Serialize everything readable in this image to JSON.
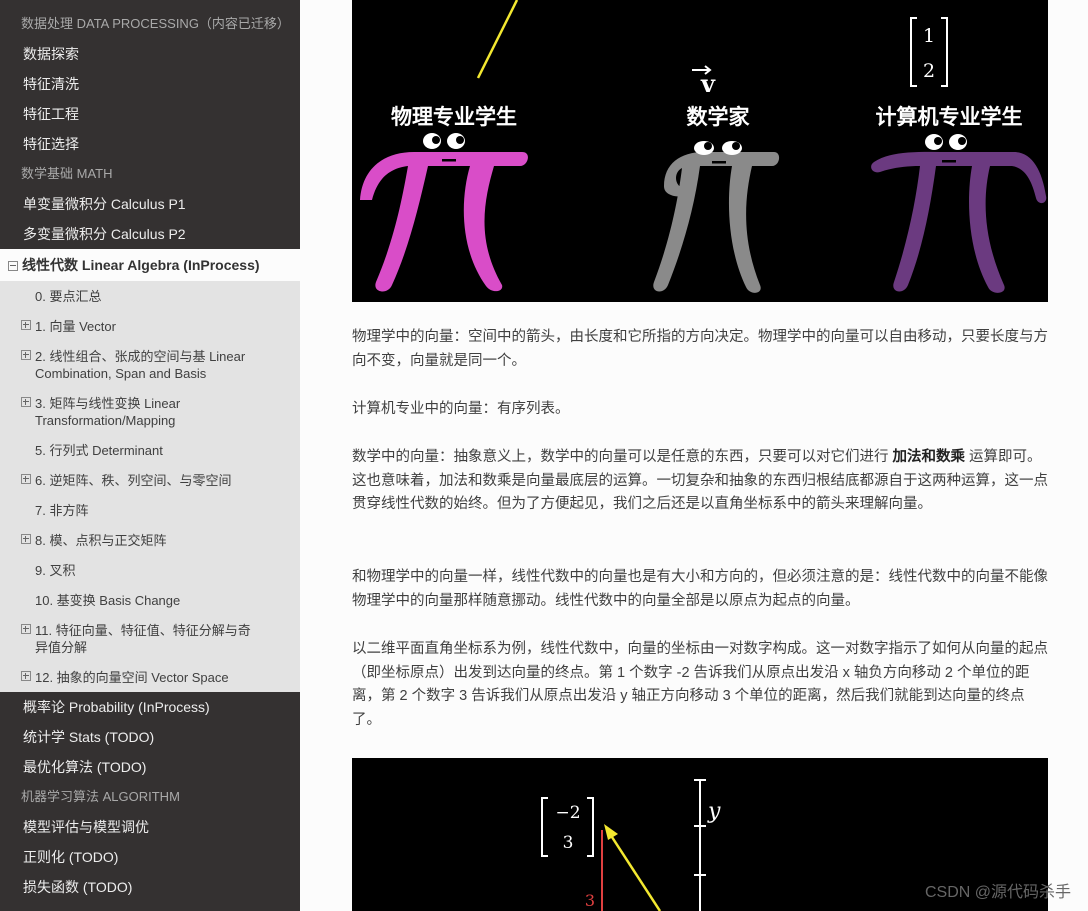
{
  "sidebar": {
    "sections": [
      {
        "caption": "数据处理 DATA PROCESSING（内容已迁移）",
        "items": [
          "数据探索",
          "特征清洗",
          "特征工程",
          "特征选择"
        ]
      },
      {
        "caption": "数学基础 MATH",
        "items": [
          "单变量微积分 Calculus P1",
          "多变量微积分 Calculus P2"
        ]
      }
    ],
    "current": {
      "label": "线性代数 Linear Algebra (InProcess)",
      "subitems": [
        {
          "label": "0. 要点汇总",
          "expandable": false
        },
        {
          "label": "1. 向量 Vector",
          "expandable": true
        },
        {
          "label": "2. 线性组合、张成的空间与基 Linear Combination, Span and Basis",
          "expandable": true
        },
        {
          "label": "3. 矩阵与线性变换 Linear Transformation/Mapping",
          "expandable": true
        },
        {
          "label": "5. 行列式 Determinant",
          "expandable": false
        },
        {
          "label": "6. 逆矩阵、秩、列空间、与零空间",
          "expandable": true
        },
        {
          "label": "7. 非方阵",
          "expandable": false
        },
        {
          "label": "8. 模、点积与正交矩阵",
          "expandable": true
        },
        {
          "label": "9. 叉积",
          "expandable": false
        },
        {
          "label": "10. 基变换 Basis Change",
          "expandable": false
        },
        {
          "label": "11. 特征向量、特征值、特征分解与奇异值分解",
          "expandable": true
        },
        {
          "label": "12. 抽象的向量空间 Vector Space",
          "expandable": true
        }
      ]
    },
    "after_current": [
      "概率论 Probability (InProcess)",
      "统计学 Stats (TODO)",
      "最优化算法 (TODO)"
    ],
    "sections2": [
      {
        "caption": "机器学习算法 ALGORITHM",
        "items": [
          "模型评估与模型调优",
          "正则化 (TODO)",
          "损失函数 (TODO)"
        ]
      }
    ]
  },
  "figure1": {
    "labels": [
      "物理专业学生",
      "数学家",
      "计算机专业学生"
    ],
    "vector_symbol": "v",
    "matrix": [
      "1",
      "2"
    ]
  },
  "paragraphs": [
    "物理学中的向量：空间中的箭头，由长度和它所指的方向决定。物理学中的向量可以自由移动，只要长度与方向不变，向量就是同一个。",
    "计算机专业中的向量：有序列表。",
    "数学中的向量：抽象意义上，数学中的向量可以是任意的东西，只要可以对它们进行 ",
    "加法和数乘",
    " 运算即可。这也意味着，加法和数乘是向量最底层的运算。一切复杂和抽象的东西归根结底都源自于这两种运算，这一点贯穿线性代数的始终。但为了方便起见，我们之后还是以直角坐标系中的箭头来理解向量。",
    "和物理学中的向量一样，线性代数中的向量也是有大小和方向的，但必须注意的是：线性代数中的向量不能像物理学中的向量那样随意挪动。线性代数中的向量全部是以原点为起点的向量。",
    "以二维平面直角坐标系为例，线性代数中，向量的坐标由一对数字构成。这一对数字指示了如何从向量的起点（即坐标原点）出发到达向量的终点。第 1 个数字 -2 告诉我们从原点出发沿 x 轴负方向移动 2 个单位的距离，第 2 个数字 3 告诉我们从原点出发沿 y 轴正方向移动 3 个单位的距离，然后我们就能到达向量的终点了。"
  ],
  "figure2": {
    "matrix": [
      "−2",
      "3"
    ],
    "axis_label": "y",
    "tick_label": "3"
  },
  "watermark": "CSDN @源代码杀手",
  "colors": {
    "sidebar_bg": "#343131",
    "subnav_bg": "#e3e3e3",
    "pi_magenta": "#d94dc8",
    "pi_gray": "#8a8a8a",
    "pi_purple": "#6b3a80",
    "arrow_yellow": "#f3e830",
    "axis_red": "#e04040"
  }
}
